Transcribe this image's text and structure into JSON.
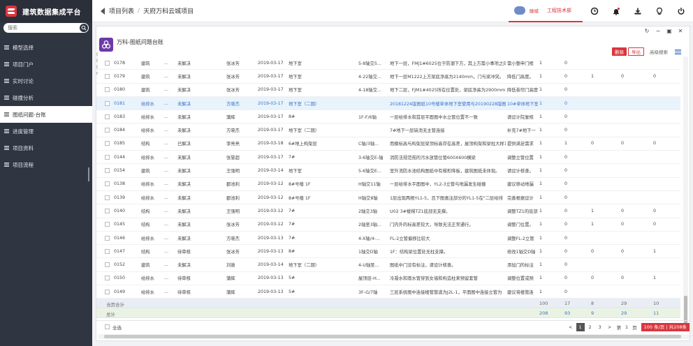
{
  "app": {
    "title": "建筑数据集成平台",
    "search_placeholder": "搜索"
  },
  "sidebar": {
    "items": [
      {
        "label": "模型选择"
      },
      {
        "label": "项目门户"
      },
      {
        "label": "实时讨论"
      },
      {
        "label": "碰撞分析"
      },
      {
        "label": "图纸问题-台账",
        "active": true
      },
      {
        "label": "进度管理"
      },
      {
        "label": "项目资料"
      },
      {
        "label": "项目流程"
      }
    ]
  },
  "breadcrumb": {
    "items": [
      "项目列表",
      "天府万科云城项目"
    ]
  },
  "user": {
    "name": "滕斌",
    "dept": "工程技术部"
  },
  "sheet": {
    "title": "万科-图纸问题台账",
    "delete_label": "删除",
    "export_label": "导出",
    "advanced_search_label": "高级搜索",
    "left_marks": [
      "(",
      "(",
      "(",
      "r"
    ]
  },
  "table": {
    "rows": [
      {
        "id": "0178",
        "major": "建筑",
        "dot": "...",
        "status": "未解决",
        "person": "张冰芳",
        "date": "2019-03-17",
        "area": "地下室",
        "axis": "5-8轴交5...",
        "desc": "地下一层，FMJ1#6025位于防潮下方，其上方需小事项之间",
        "note": "需小整申门框",
        "n1": "1",
        "n2": "0",
        "n3": "",
        "n4": "",
        "n5": ""
      },
      {
        "id": "0179",
        "major": "建筑",
        "dot": "...",
        "status": "未解决",
        "person": "张冰芳",
        "date": "2019-03-17",
        "area": "地下室",
        "axis": "4-22轴交...",
        "desc": "地下一层M1222上方梁底净高为2140mm，门与梁冲突。",
        "note": "降低门高度。",
        "n1": "1",
        "n2": "0",
        "n3": "1",
        "n4": "0",
        "n5": "0"
      },
      {
        "id": "0180",
        "major": "建筑",
        "dot": "...",
        "status": "未解决",
        "person": "张冰芳",
        "date": "2019-03-17",
        "area": "地下室",
        "axis": "4-18轴交...",
        "desc": "地下二层，FJM1#4025所在位置处，梁底净高为2900mm，",
        "note": "降低卷帘门高度",
        "n1": "1",
        "n2": "0",
        "n3": "",
        "n4": "",
        "n5": ""
      },
      {
        "id": "0181",
        "major": "给排水",
        "dot": "...",
        "status": "未解决",
        "person": "方晓杰",
        "date": "2019-03-17",
        "area": "地下室（二期）",
        "axis": "",
        "desc": "20181224版图纸10号楼单体地下室使用与20190228版图",
        "note": "10#单体地下室",
        "n1": "1",
        "n2": "0",
        "n3": "",
        "n4": "",
        "n5": "",
        "highlight": true
      },
      {
        "id": "0183",
        "major": "给排水",
        "dot": "...",
        "status": "未解决",
        "person": "蒲辉",
        "date": "2019-03-17",
        "area": "8#",
        "axis": "1F-F/6轴",
        "desc": "一层给排水和首层平面图中水立管位置不一致",
        "note": "请设计院复核",
        "n1": "1",
        "n2": "0",
        "n3": "",
        "n4": "",
        "n5": ""
      },
      {
        "id": "0184",
        "major": "给排水",
        "dot": "...",
        "status": "未解决",
        "person": "方晓杰",
        "date": "2019-03-17",
        "area": "地下室（二期）",
        "axis": "",
        "desc": "7#地下一层缺消无主管连接",
        "note": "补充7#地下一",
        "n1": "1",
        "n2": "0",
        "n3": "",
        "n4": "",
        "n5": ""
      },
      {
        "id": "0185",
        "major": "结构",
        "dot": "...",
        "status": "已解决",
        "person": "李亮亮",
        "date": "2019-03-18",
        "area": "6#地上构架层",
        "axis": "C轴/3轴...",
        "desc": "而模标高与构架层梁顶标高存在高差，屋顶构架和梁柱大样1:",
        "note": "提供满足需求",
        "n1": "1",
        "n2": "1",
        "n3": "0",
        "n4": "0",
        "n5": "0"
      },
      {
        "id": "0144",
        "major": "给排水",
        "dot": "...",
        "status": "未解决",
        "person": "张慧超",
        "date": "2019-03-17",
        "area": "7#",
        "axis": "3-6轴交E-轴",
        "desc": "消防法规范规的污水放管位管600X600横梁",
        "note": "调整立管位置",
        "n1": "1",
        "n2": "0",
        "n3": "",
        "n4": "",
        "n5": ""
      },
      {
        "id": "0154",
        "major": "建筑",
        "dot": "...",
        "status": "未解决",
        "person": "王强明",
        "date": "2019-03-14",
        "area": "地下室",
        "axis": "5-6轴交E...",
        "desc": "室外消防水池结构图纸中有梯形降板，建筑图纸未体现。",
        "note": "请设计核查。",
        "n1": "1",
        "n2": "0",
        "n3": "",
        "n4": "",
        "n5": ""
      },
      {
        "id": "0138",
        "major": "给排水",
        "dot": "...",
        "status": "未解决",
        "person": "郡池利",
        "date": "2019-03-12",
        "area": "8#号楼 1F",
        "axis": "H轴交11轴",
        "desc": "一层给排水平面图中，YL2-3立管与地漏发生碰撞",
        "note": "建议移动地漏",
        "n1": "1",
        "n2": "0",
        "n3": "",
        "n4": "",
        "n5": ""
      },
      {
        "id": "0139",
        "major": "给排水",
        "dot": "...",
        "status": "未解决",
        "person": "郡池利",
        "date": "2019-03-12",
        "area": "8#号楼 1F",
        "axis": "H轴交8轴",
        "desc": "1层出现两根YL1-5，且下图画注部分的YL1-5在\"二层给排",
        "note": "完善根据设计",
        "n1": "1",
        "n2": "0",
        "n3": "",
        "n4": "",
        "n5": ""
      },
      {
        "id": "0140",
        "major": "结构",
        "dot": "...",
        "status": "未解决",
        "person": "王强明",
        "date": "2019-03-12",
        "area": "7#",
        "axis": "2轴交3轴",
        "desc": "U02 3#楼梯TZ1底部无支撑。",
        "note": "调整TZ1的底部",
        "n1": "1",
        "n2": "0",
        "n3": "1",
        "n4": "0",
        "n5": "0"
      },
      {
        "id": "0145",
        "major": "结构",
        "dot": "...",
        "status": "未解决",
        "person": "张冰芳",
        "date": "2019-03-12",
        "area": "7#",
        "axis": "2轴至3轴...",
        "desc": "门内外的标高差较大，导致无法正常通行。",
        "note": "调整门位置。",
        "n1": "1",
        "n2": "0",
        "n3": "1",
        "n4": "0",
        "n5": "0"
      },
      {
        "id": "0146",
        "major": "给排水",
        "dot": "...",
        "status": "未解决",
        "person": "方晓杰",
        "date": "2019-03-13",
        "area": "7#",
        "axis": "4-X轴/4-...",
        "desc": "FL-2立管偏移比较大",
        "note": "调整FL-2立管",
        "n1": "1",
        "n2": "0",
        "n3": "",
        "n4": "",
        "n5": ""
      },
      {
        "id": "0147",
        "major": "结构",
        "dot": "...",
        "status": "待审核",
        "person": "张冰芳",
        "date": "2019-03-13",
        "area": "8#",
        "axis": "1轴交D轴",
        "desc": "1F：结构梁位置处无柱支撑。",
        "note": "修改1轴交D轴",
        "n1": "1",
        "n2": "0",
        "n3": "0",
        "n4": "0",
        "n5": "1"
      },
      {
        "id": "0152",
        "major": "建筑",
        "dot": "...",
        "status": "未解决",
        "person": "刘敦",
        "date": "2019-03-14",
        "area": "地下室（二期）",
        "axis": "4-U轴至...",
        "desc": "图纸中门没有标注，请设计核查。",
        "note": "添加门的标注",
        "n1": "1",
        "n2": "0",
        "n3": "",
        "n4": "",
        "n5": ""
      },
      {
        "id": "0150",
        "major": "给排水",
        "dot": "...",
        "status": "待审核",
        "person": "蒲辉",
        "date": "2019-03-13",
        "area": "5#",
        "axis": "屋顶层-H...",
        "desc": "冷凝水和雨水管穿到女墙和构造柱来预留套管",
        "note": "调整位置或预",
        "n1": "1",
        "n2": "0",
        "n3": "0",
        "n4": "0",
        "n5": "1"
      },
      {
        "id": "0149",
        "major": "给排水",
        "dot": "...",
        "status": "待审核",
        "person": "蒲辉",
        "date": "2019-03-13",
        "area": "5#",
        "axis": "3F-G/7轴",
        "desc": "三层系统图中连接楼管管道为J2L-1，平面图中连接立管为",
        "note": "建议将楼管连",
        "n1": "1",
        "n2": "0",
        "n3": "",
        "n4": "",
        "n5": ""
      }
    ],
    "page_total": {
      "label": "当页合计",
      "v1": "100",
      "v2": "17",
      "v3": "8",
      "v4": "29",
      "v5": "10"
    },
    "grand_total": {
      "label": "总计",
      "v1": "208",
      "v2": "93",
      "v3": "9",
      "v4": "29",
      "v5": "11"
    }
  },
  "footer": {
    "select_all": "全选",
    "prev": "<",
    "pages": [
      "1",
      "2",
      "3"
    ],
    "next": ">",
    "goto_prefix": "第",
    "goto_value": "1",
    "goto_suffix": "页",
    "page_size": "100 条/页 | 共208条"
  }
}
